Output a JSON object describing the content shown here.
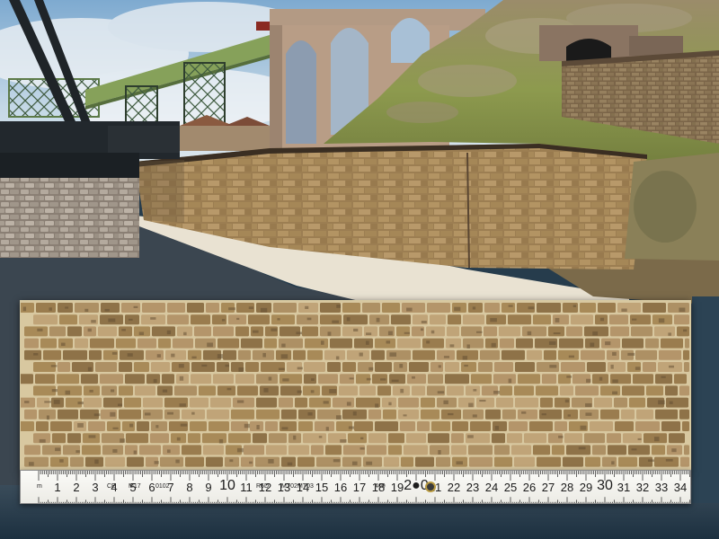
{
  "image": {
    "subject": "model railway retaining wall scene with stone wall panel and folding ruler",
    "colors": {
      "sky": "#9cc0dc",
      "stone": "#a88a58",
      "stone_dark": "#6e5a3a",
      "mortar": "#d9c8a0",
      "ground_sand": "#e9e2d2",
      "ground_asphalt": "#3b4650",
      "grass": "#8d9a4e",
      "bridge_green": "#87a35c",
      "viaduct": "#b89d86",
      "crane_dark": "#1f2428"
    }
  },
  "ruler": {
    "numbers": [
      "1",
      "2",
      "3",
      "4",
      "5",
      "6",
      "7",
      "8",
      "9",
      "10",
      "11",
      "12",
      "13",
      "14",
      "15",
      "16",
      "17",
      "18",
      "19",
      "20",
      "21",
      "22",
      "23",
      "24",
      "25",
      "26",
      "27",
      "28",
      "29",
      "30",
      "31",
      "32",
      "33",
      "34"
    ],
    "markings": [
      "m",
      "CE",
      "M17",
      "0102",
      "R6D",
      "MT02",
      "MT03",
      "400"
    ],
    "center_mark": "2●0"
  }
}
